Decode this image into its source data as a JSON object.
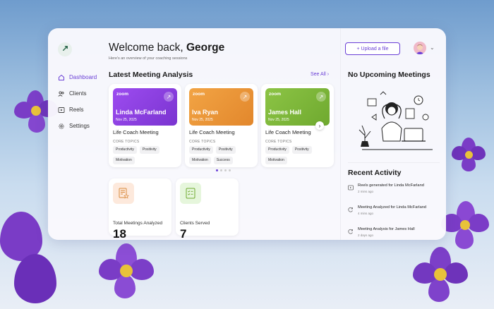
{
  "sidebar": {
    "items": [
      {
        "label": "Dashboard",
        "icon": "home-icon",
        "active": true
      },
      {
        "label": "Clients",
        "icon": "users-icon",
        "active": false
      },
      {
        "label": "Reels",
        "icon": "video-icon",
        "active": false
      },
      {
        "label": "Settings",
        "icon": "gear-icon",
        "active": false
      }
    ]
  },
  "header": {
    "welcome_prefix": "Welcome back,",
    "user_name": "George",
    "subtitle": "Here's an overview of your coaching sessions",
    "upload_label": "+ Upload a file"
  },
  "meetings": {
    "title": "Latest Meeting Analysis",
    "see_all": "See All",
    "cards": [
      {
        "platform": "zoom",
        "name": "Linda McFarland",
        "date": "Nov 25, 2025",
        "title": "Life Coach Meeting",
        "core_label": "CORE TOPICS",
        "tags": [
          "Productivity",
          "Positivity",
          "Motivation"
        ],
        "color": "#8b3fe0"
      },
      {
        "platform": "zoom",
        "name": "Iva Ryan",
        "date": "Nov 25, 2025",
        "title": "Life Coach Meeting",
        "core_label": "CORE TOPICS",
        "tags": [
          "Productivity",
          "Positivity",
          "Motivation",
          "Success"
        ],
        "color": "#ee9a3c"
      },
      {
        "platform": "zoom",
        "name": "James Hall",
        "date": "Nov 25, 2025",
        "title": "Life Coach Meeting",
        "core_label": "CORE TOPICS",
        "tags": [
          "Productivity",
          "Positivity",
          "Motivation"
        ],
        "color": "#7fb83a"
      }
    ]
  },
  "stats": [
    {
      "label": "Total Meetings Analyzed",
      "value": "18",
      "icon": "document-star-icon"
    },
    {
      "label": "Clients Served",
      "value": "7",
      "icon": "checklist-icon"
    }
  ],
  "upcoming": {
    "title": "No Upcoming Meetings"
  },
  "activity": {
    "title": "Recent Activity",
    "items": [
      {
        "text": "Reels generated for Linda McFarland",
        "time": "2 mins ago",
        "icon": "play-icon"
      },
      {
        "text": "Meeting Analyzed for Linda McFarland",
        "time": "4 mins ago",
        "icon": "refresh-icon"
      },
      {
        "text": "Meeting Analysis for James Hall",
        "time": "2 days ago",
        "icon": "refresh-icon"
      }
    ]
  },
  "colors": {
    "accent": "#6a3fd6"
  }
}
